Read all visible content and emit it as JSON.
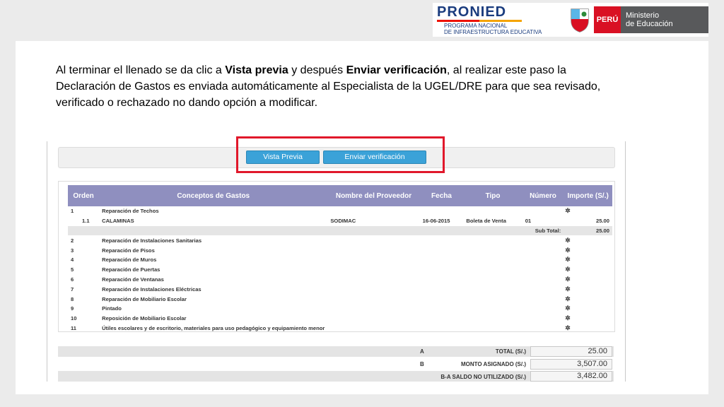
{
  "header": {
    "pronied_name": "PRONIED",
    "pronied_line1": "PROGRAMA NACIONAL",
    "pronied_line2": "DE INFRAESTRUCTURA EDUCATIVA",
    "peru": "PERÚ",
    "ministry_line1": "Ministerio",
    "ministry_line2": "de Educación"
  },
  "instructions": {
    "part1": "Al terminar el llenado se da clic a ",
    "bold1": "Vista previa",
    "part2": " y después ",
    "bold2": "Enviar verificación",
    "part3": ",  al realizar este paso la Declaración de Gastos es enviada automáticamente al Especialista de la UGEL/DRE para que sea revisado, verificado o rechazado no dando opción a modificar."
  },
  "toolbar": {
    "preview_label": "Vista Previa",
    "send_label": "Enviar verificación"
  },
  "table": {
    "headers": [
      "Orden",
      "Conceptos de Gastos",
      "Nombre del Proveedor",
      "Fecha",
      "Tipo",
      "Número",
      "Importe (S/.)"
    ],
    "rows": [
      {
        "orden": "1",
        "concepto": "Reparación de Techos",
        "proveedor": "",
        "fecha": "",
        "tipo": "",
        "numero": "",
        "importe": "",
        "icon": true,
        "indent": false
      },
      {
        "orden": "1.1",
        "concepto": "CALAMINAS",
        "proveedor": "SODIMAC",
        "fecha": "16-06-2015",
        "tipo": "Boleta de Venta",
        "numero": "01",
        "importe": "25.00",
        "icon": false,
        "indent": true
      },
      {
        "orden": "",
        "concepto": "",
        "proveedor": "",
        "fecha": "",
        "tipo": "",
        "numero": "Sub Total:",
        "importe": "25.00",
        "icon": false,
        "indent": false,
        "subtotal": true
      },
      {
        "orden": "2",
        "concepto": "Reparación de Instalaciones Sanitarias",
        "icon": true
      },
      {
        "orden": "3",
        "concepto": "Reparación de Pisos",
        "icon": true
      },
      {
        "orden": "4",
        "concepto": "Reparación de Muros",
        "icon": true
      },
      {
        "orden": "5",
        "concepto": "Reparación de Puertas",
        "icon": true
      },
      {
        "orden": "6",
        "concepto": "Reparación de Ventanas",
        "icon": true
      },
      {
        "orden": "7",
        "concepto": "Reparación de Instalaciones Eléctricas",
        "icon": true
      },
      {
        "orden": "8",
        "concepto": "Reparación de Mobiliario Escolar",
        "icon": true
      },
      {
        "orden": "9",
        "concepto": "Pintado",
        "icon": true
      },
      {
        "orden": "10",
        "concepto": "Reposición de Mobiliario Escolar",
        "icon": true
      },
      {
        "orden": "11",
        "concepto": "Útiles escolares y de escritorio, materiales para uso pedagógico y equipamiento menor",
        "icon": true
      }
    ]
  },
  "totals": {
    "a_letter": "A",
    "a_label": "TOTAL  (S/.)",
    "a_value": "25.00",
    "b_letter": "B",
    "b_label": "MONTO ASIGNADO  (S/.)",
    "b_value": "3,507.00",
    "c_label": "B-A SALDO NO UTILIZADO  (S/.)",
    "c_value": "3,482.00"
  }
}
